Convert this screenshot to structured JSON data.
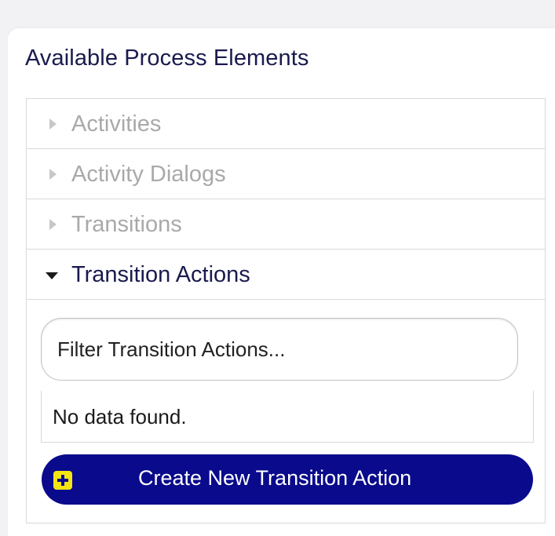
{
  "panel": {
    "title": "Available Process Elements"
  },
  "sections": [
    {
      "label": "Activities",
      "state": "collapsed"
    },
    {
      "label": "Activity Dialogs",
      "state": "collapsed"
    },
    {
      "label": "Transitions",
      "state": "collapsed"
    },
    {
      "label": "Transition Actions",
      "state": "expanded"
    }
  ],
  "transition_actions": {
    "filter_placeholder": "Filter Transition Actions...",
    "empty_message": "No data found.",
    "create_button_label": "Create New Transition Action",
    "create_button_icon": "plus-square-icon"
  },
  "colors": {
    "title_text": "#1a1a4e",
    "collapsed_text": "#a9a9a9",
    "button_bg": "#0a0a8c",
    "button_icon_bg": "#f4e414"
  }
}
